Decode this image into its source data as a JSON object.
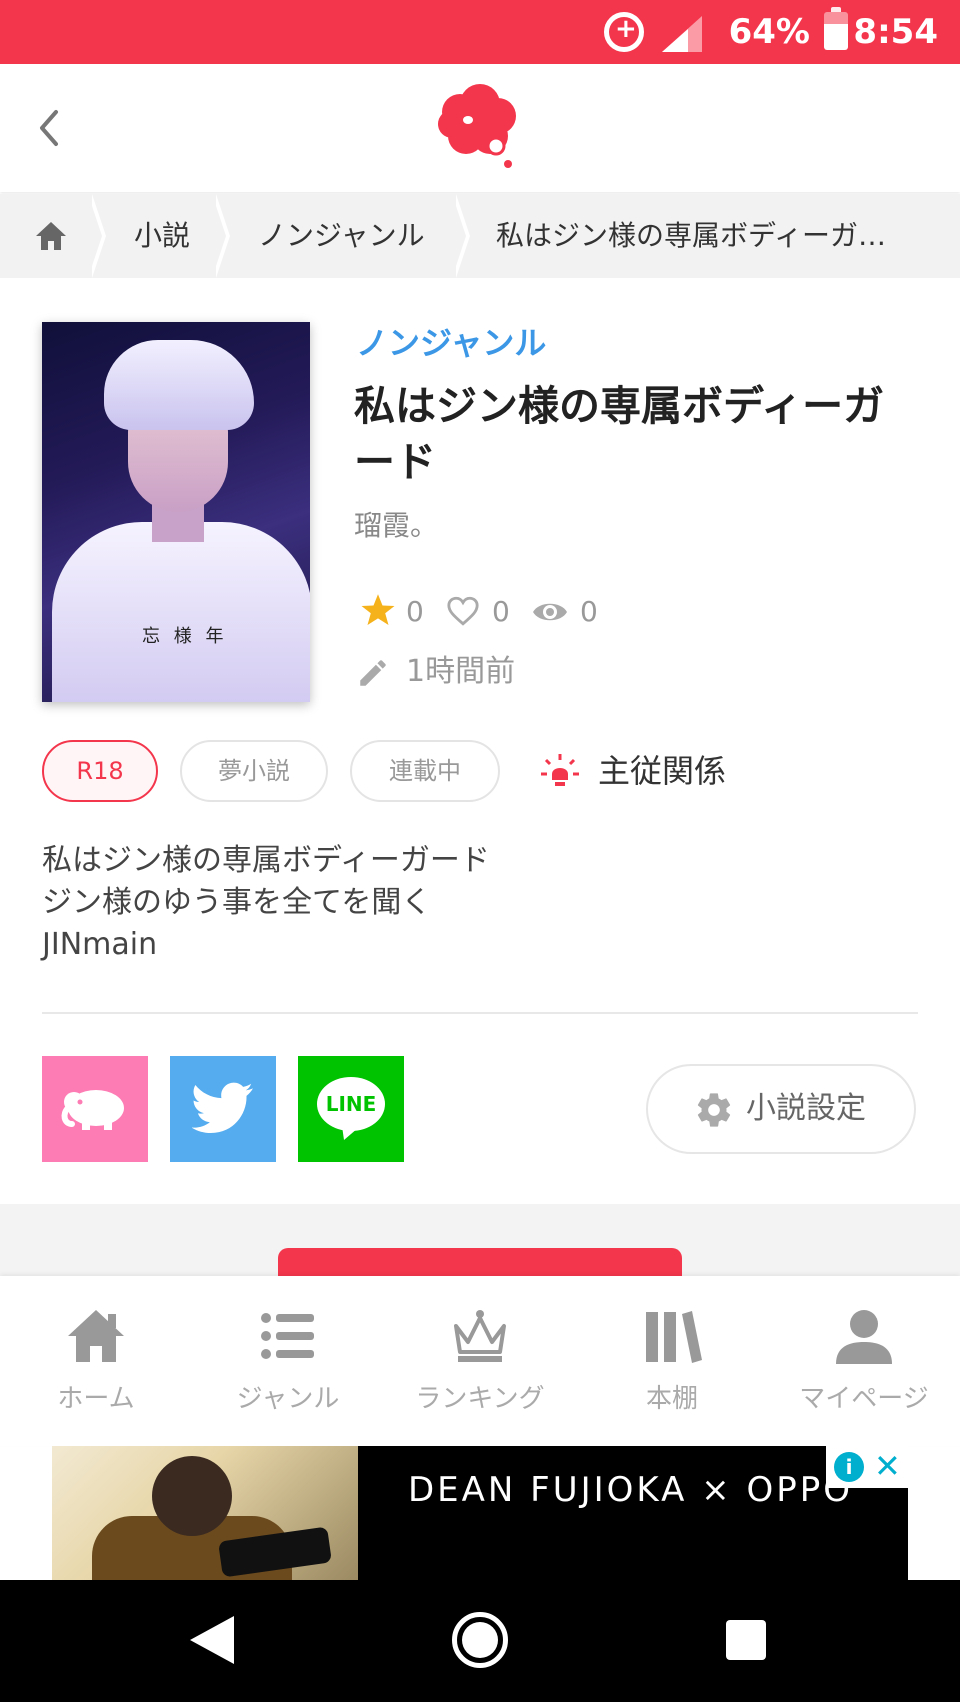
{
  "status_bar": {
    "battery": "64%",
    "time": "8:54"
  },
  "breadcrumb": {
    "items": [
      "小説",
      "ノンジャンル",
      "私はジン様の専属ボディーガ…"
    ]
  },
  "novel": {
    "genre": "ノンジャンル",
    "title": "私はジン様の専属ボディーガード",
    "author": "瑠霞。",
    "stars": "0",
    "likes": "0",
    "views": "0",
    "updated": "1時間前",
    "tags": [
      "R18",
      "夢小説",
      "連載中"
    ],
    "keyword": "主従関係",
    "description": [
      "私はジン様の専属ボディーガード",
      "ジン様のゆう事を全てを聞く",
      "JINmain"
    ],
    "cover_shirt_text": "忘 様 年"
  },
  "share": {
    "settings_label": "小説設定",
    "line_label": "LINE"
  },
  "bottom_nav": {
    "items": [
      {
        "label": "ホーム",
        "icon": "home-icon"
      },
      {
        "label": "ジャンル",
        "icon": "list-icon"
      },
      {
        "label": "ランキング",
        "icon": "crown-icon"
      },
      {
        "label": "本棚",
        "icon": "bookshelf-icon"
      },
      {
        "label": "マイページ",
        "icon": "person-icon"
      }
    ]
  },
  "ad": {
    "text": "DEAN FUJIOKA × OPPO"
  },
  "colors": {
    "accent": "#f4364c",
    "genre": "#3c98e6",
    "star": "#f5b21b"
  }
}
